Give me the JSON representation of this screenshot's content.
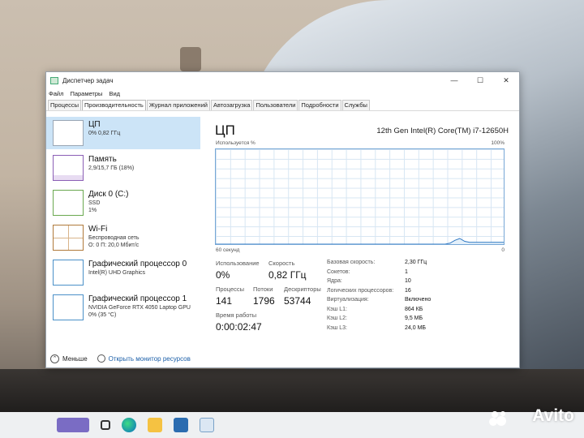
{
  "window": {
    "title": "Диспетчер задач",
    "controls": {
      "minimize": "—",
      "maximize": "☐",
      "close": "✕"
    }
  },
  "menu": [
    "Файл",
    "Параметры",
    "Вид"
  ],
  "tabs": [
    "Процессы",
    "Производительность",
    "Журнал приложений",
    "Автозагрузка",
    "Пользователи",
    "Подробности",
    "Службы"
  ],
  "active_tab_index": 1,
  "resources": [
    {
      "name": "ЦП",
      "sub1": "0% 0,82 ГГц",
      "sub2": ""
    },
    {
      "name": "Память",
      "sub1": "2,9/15,7 ГБ (18%)",
      "sub2": ""
    },
    {
      "name": "Диск 0 (C:)",
      "sub1": "SSD",
      "sub2": "1%"
    },
    {
      "name": "Wi-Fi",
      "sub1": "Беспроводная сеть",
      "sub2": "О: 0 П: 20,0 Мбит/с"
    },
    {
      "name": "Графический процессор 0",
      "sub1": "Intel(R) UHD Graphics",
      "sub2": ""
    },
    {
      "name": "Графический процессор 1",
      "sub1": "NVIDIA GeForce RTX 4050 Laptop GPU",
      "sub2": "0% (35 °C)"
    }
  ],
  "cpu": {
    "title": "ЦП",
    "model": "12th Gen Intel(R) Core(TM) i7-12650H",
    "graph_top_left": "Используется %",
    "graph_top_right": "100%",
    "graph_bottom_left": "60 секунд",
    "graph_bottom_right": "0",
    "usage_label": "Использование",
    "usage_value": "0%",
    "speed_label": "Скорость",
    "speed_value": "0,82 ГГц",
    "processes_label": "Процессы",
    "processes_value": "141",
    "threads_label": "Потоки",
    "threads_value": "1796",
    "handles_label": "Дескрипторы",
    "handles_value": "53744",
    "uptime_label": "Время работы",
    "uptime_value": "0:00:02:47",
    "specs": [
      {
        "k": "Базовая скорость:",
        "v": "2,30 ГГц"
      },
      {
        "k": "Сокетов:",
        "v": "1"
      },
      {
        "k": "Ядра:",
        "v": "10"
      },
      {
        "k": "Логических процессоров:",
        "v": "16"
      },
      {
        "k": "Виртуализация:",
        "v": "Включено"
      },
      {
        "k": "Кэш L1:",
        "v": "864 КБ"
      },
      {
        "k": "Кэш L2:",
        "v": "9,5 МБ"
      },
      {
        "k": "Кэш L3:",
        "v": "24,0 МБ"
      }
    ],
    "usage_series_pct": [
      0,
      0,
      0,
      0,
      0,
      0,
      0,
      0,
      0,
      0,
      0,
      0,
      0,
      0,
      0,
      0,
      0,
      0,
      0,
      0,
      0,
      0,
      0,
      0,
      0,
      0,
      0,
      0,
      0,
      0,
      0,
      0,
      0,
      0,
      0,
      0,
      0,
      0,
      0,
      0,
      0,
      0,
      0,
      0,
      0,
      0,
      0,
      0,
      1,
      4,
      6,
      3,
      2,
      2,
      2,
      2,
      2,
      2,
      2,
      2
    ]
  },
  "footer": {
    "less_label": "Меньше",
    "monitor_label": "Открыть монитор ресурсов"
  },
  "watermark": "Avito",
  "colors": {
    "selected": "#cce4f7",
    "cpu_accent": "#76a7d6",
    "link": "#1a5ea8"
  }
}
